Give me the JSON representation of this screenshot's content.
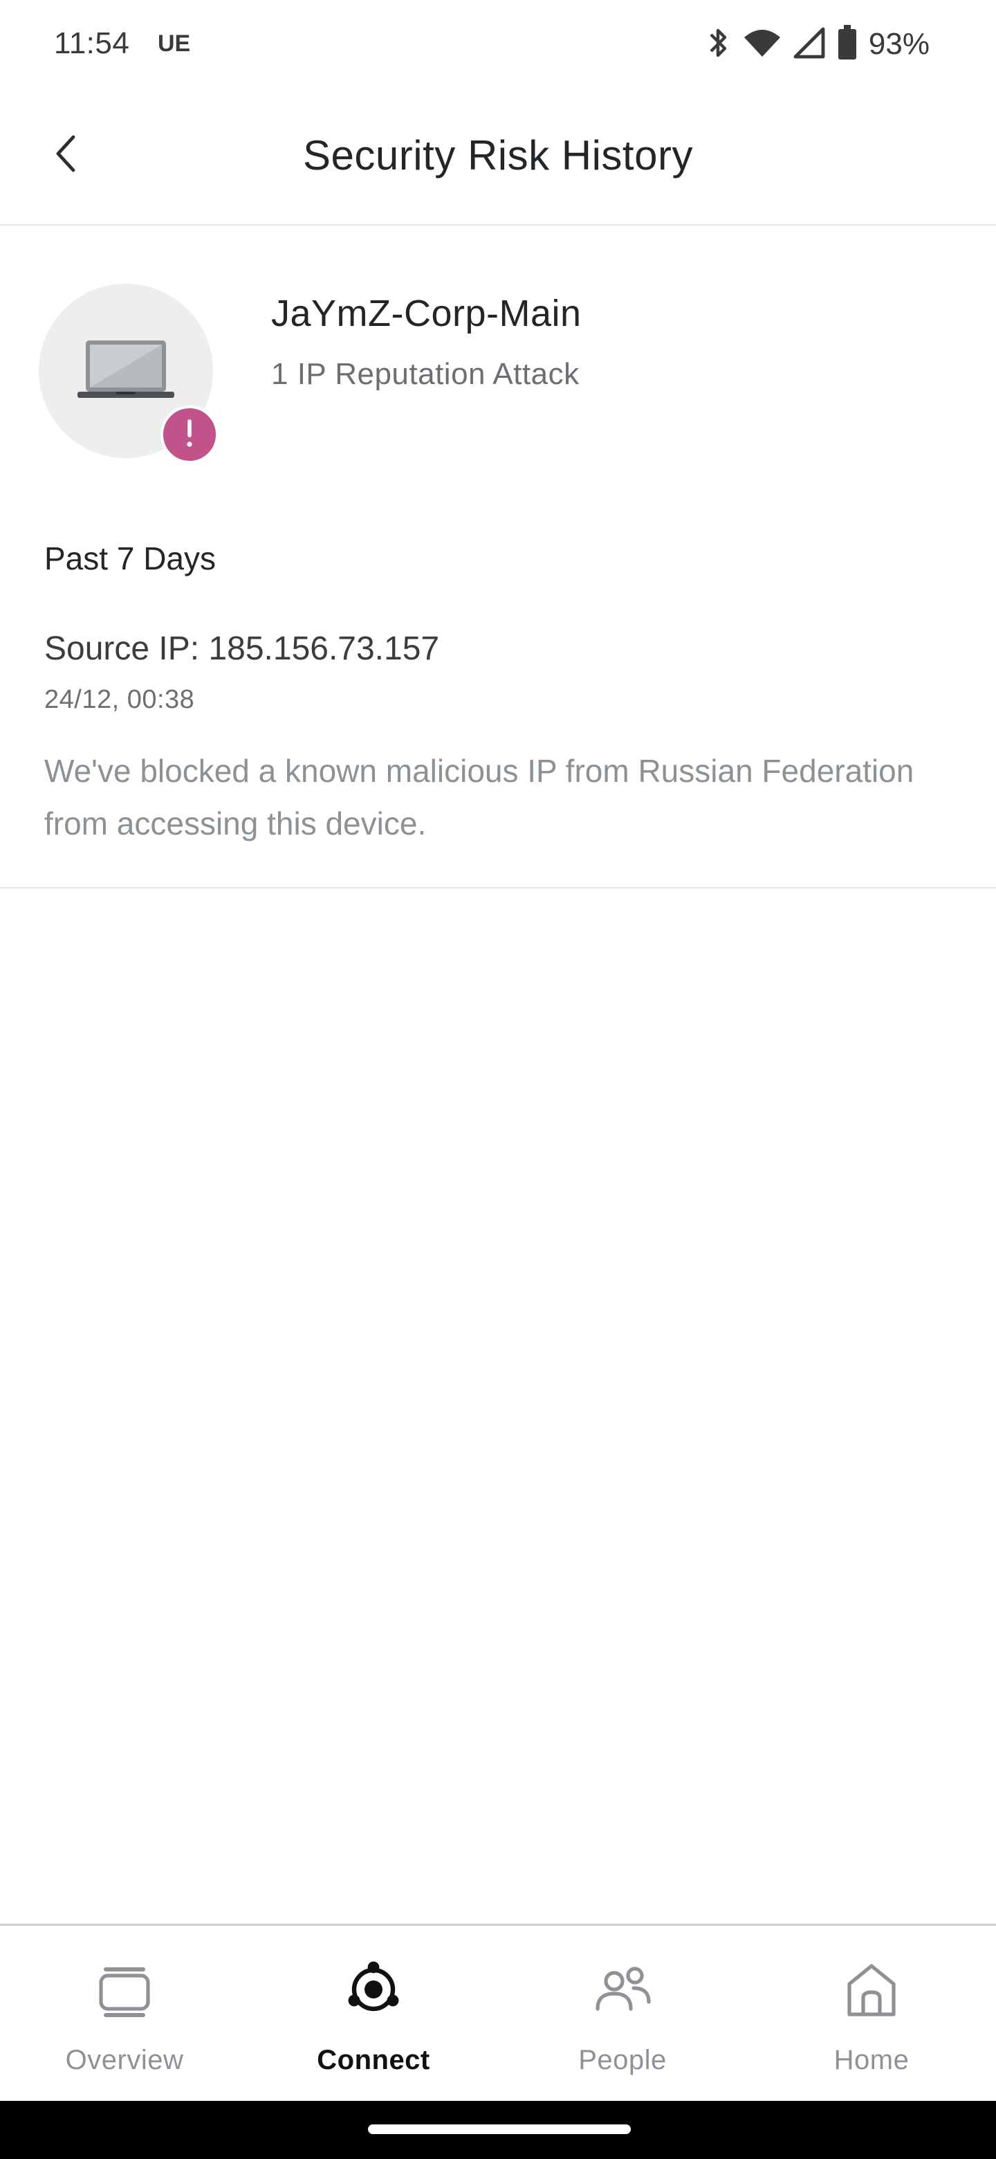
{
  "status_bar": {
    "time": "11:54",
    "carrier_label": "UE",
    "battery_percent": "93%",
    "icons": [
      "bluetooth-icon",
      "wifi-icon",
      "signal-icon",
      "battery-icon"
    ]
  },
  "header": {
    "title": "Security Risk History",
    "back_icon": "chevron-left-icon"
  },
  "device": {
    "name": "JaYmZ-Corp-Main",
    "summary": "1 IP Reputation Attack",
    "icon": "laptop-icon",
    "badge_icon": "exclamation-icon",
    "badge_color": "#c2528a"
  },
  "history": {
    "period_label": "Past 7 Days",
    "events": [
      {
        "title": "Source IP: 185.156.73.157",
        "timestamp": "24/12, 00:38",
        "description": "We've blocked a known malicious IP from Russian Federation from accessing this device."
      }
    ]
  },
  "bottom_nav": {
    "items": [
      {
        "label": "Overview",
        "icon": "overview-icon",
        "active": false
      },
      {
        "label": "Connect",
        "icon": "connect-icon",
        "active": true
      },
      {
        "label": "People",
        "icon": "people-icon",
        "active": false
      },
      {
        "label": "Home",
        "icon": "home-icon",
        "active": false
      }
    ]
  },
  "colors": {
    "accent_alert": "#c2528a",
    "inactive_nav": "#8e9297",
    "active_nav": "#111111"
  }
}
